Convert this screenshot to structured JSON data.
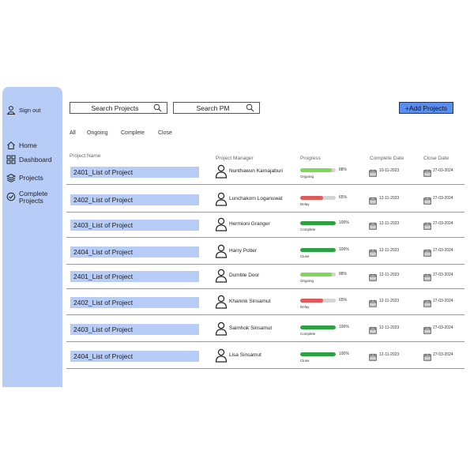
{
  "sidebar": {
    "sign_out": "Sign out",
    "items": [
      {
        "label": "Home",
        "icon": "home-icon"
      },
      {
        "label": "Dashboard",
        "icon": "dashboard-icon"
      },
      {
        "label": "Projects",
        "icon": "layers-icon"
      },
      {
        "label": "Complete Projects",
        "icon": "check-circle-icon"
      }
    ]
  },
  "toolbar": {
    "search_projects": "Search Projects",
    "search_pm": "Search PM",
    "add_projects": "+Add Projects"
  },
  "filters": [
    "All",
    "Ongoing",
    "Complete",
    "Close"
  ],
  "columns": {
    "project_name": "Project Name",
    "project_manager": "Project Manager",
    "progress": "Progress",
    "complete_date": "Complete Date",
    "close_date": "Close Date"
  },
  "colors": {
    "accent": "#5b8def",
    "sidebar": "#b7cdf7",
    "green": "#2ea043",
    "red": "#e05a5a",
    "light_green": "#7ed957"
  },
  "rows": [
    {
      "project": "2401_List of Project",
      "pm": "Nunthawun Karnajaburi",
      "progress": 0.88,
      "pct": "88%",
      "status": "Ongoing",
      "complete_date": "10-11-2023",
      "close_date": "27-03-2024",
      "bar_color": "#7ed957"
    },
    {
      "project": "2402_List of Project",
      "pm": "Lunchakorn Loganuwat",
      "progress": 0.65,
      "pct": "65%",
      "status": "Delay",
      "complete_date": "12-11-2023",
      "close_date": "27-03-2024",
      "bar_color": "#e05a5a"
    },
    {
      "project": "2403_List of Project",
      "pm": "Hermioni Granger",
      "progress": 1.0,
      "pct": "100%",
      "status": "Complete",
      "complete_date": "12-11-2023",
      "close_date": "27-03-2024",
      "bar_color": "#2ea043"
    },
    {
      "project": "2404_List of Project",
      "pm": "Harry Potter",
      "progress": 1.0,
      "pct": "100%",
      "status": "Close",
      "complete_date": "12-11-2023",
      "close_date": "27-03-2024",
      "bar_color": "#2ea043"
    },
    {
      "project": "2401_List of Project",
      "pm": "Dumble Door",
      "progress": 0.88,
      "pct": "88%",
      "status": "Ongoing",
      "complete_date": "12-11-2023",
      "close_date": "27-03-2024",
      "bar_color": "#7ed957"
    },
    {
      "project": "2402_List of Project",
      "pm": "Khanink Sinsamut",
      "progress": 0.65,
      "pct": "65%",
      "status": "Delay",
      "complete_date": "12-11-2023",
      "close_date": "27-03-2024",
      "bar_color": "#e05a5a"
    },
    {
      "project": "2403_List of Project",
      "pm": "Saimhok Sinsamut",
      "progress": 1.0,
      "pct": "100%",
      "status": "Complete",
      "complete_date": "12-11-2023",
      "close_date": "27-03-2024",
      "bar_color": "#2ea043"
    },
    {
      "project": "2404_List of Project",
      "pm": "Lisa Sinsamut",
      "progress": 1.0,
      "pct": "100%",
      "status": "Close",
      "complete_date": "12-11-2023",
      "close_date": "27-03-2024",
      "bar_color": "#2ea043"
    }
  ]
}
